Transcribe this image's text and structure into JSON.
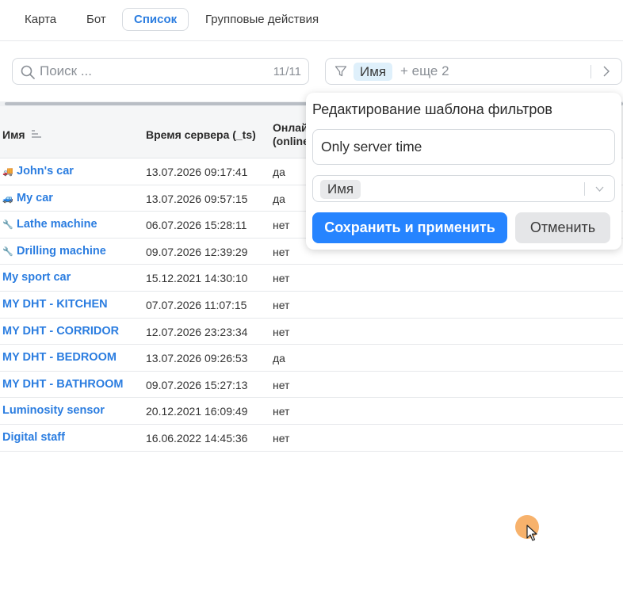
{
  "tabs": [
    {
      "label": "Карта"
    },
    {
      "label": "Бот"
    },
    {
      "label": "Список",
      "active": true
    },
    {
      "label": "Групповые действия"
    }
  ],
  "search": {
    "placeholder": "Поиск ...",
    "count": "11/11"
  },
  "filter": {
    "chip": "Имя",
    "more": "+ еще 2"
  },
  "table": {
    "columns": [
      "Имя",
      "Время сервера (_ts)",
      "Онлай",
      "(online"
    ],
    "rows": [
      {
        "icon": "truck-icon",
        "glyph": "🚚",
        "name": "John's car",
        "time": "13.07.2026 09:17:41",
        "online": "да"
      },
      {
        "icon": "car-icon",
        "glyph": "🚙",
        "name": "My car",
        "time": "13.07.2026 09:57:15",
        "online": "да"
      },
      {
        "icon": "wrench-icon",
        "glyph": "🔧",
        "name": "Lathe machine",
        "time": "06.07.2026 15:28:11",
        "online": "нет"
      },
      {
        "icon": "wrench-icon",
        "glyph": "🔧",
        "name": "Drilling machine",
        "time": "09.07.2026 12:39:29",
        "online": "нет"
      },
      {
        "icon": "",
        "glyph": "",
        "name": "My sport car",
        "time": "15.12.2021 14:30:10",
        "online": "нет"
      },
      {
        "icon": "",
        "glyph": "",
        "name": "MY DHT - KITCHEN",
        "time": "07.07.2026 11:07:15",
        "online": "нет"
      },
      {
        "icon": "",
        "glyph": "",
        "name": "MY DHT - CORRIDOR",
        "time": "12.07.2026 23:23:34",
        "online": "нет"
      },
      {
        "icon": "",
        "glyph": "",
        "name": "MY DHT - BEDROOM",
        "time": "13.07.2026 09:26:53",
        "online": "да"
      },
      {
        "icon": "",
        "glyph": "",
        "name": "MY DHT - BATHROOM",
        "time": "09.07.2026 15:27:13",
        "online": "нет"
      },
      {
        "icon": "",
        "glyph": "",
        "name": "Luminosity sensor",
        "time": "20.12.2021 16:09:49",
        "online": "нет"
      },
      {
        "icon": "",
        "glyph": "",
        "name": "Digital staff",
        "time": "16.06.2022 14:45:36",
        "online": "нет"
      }
    ]
  },
  "popover": {
    "title": "Редактирование шаблона фильтров",
    "template_name": "Only server time",
    "selected_tag": "Имя",
    "save_label": "Сохранить и применить",
    "cancel_label": "Отменить"
  },
  "colors": {
    "accent": "#2b7de0",
    "primary_button": "#2684ff",
    "cursor": "#f6a552"
  }
}
